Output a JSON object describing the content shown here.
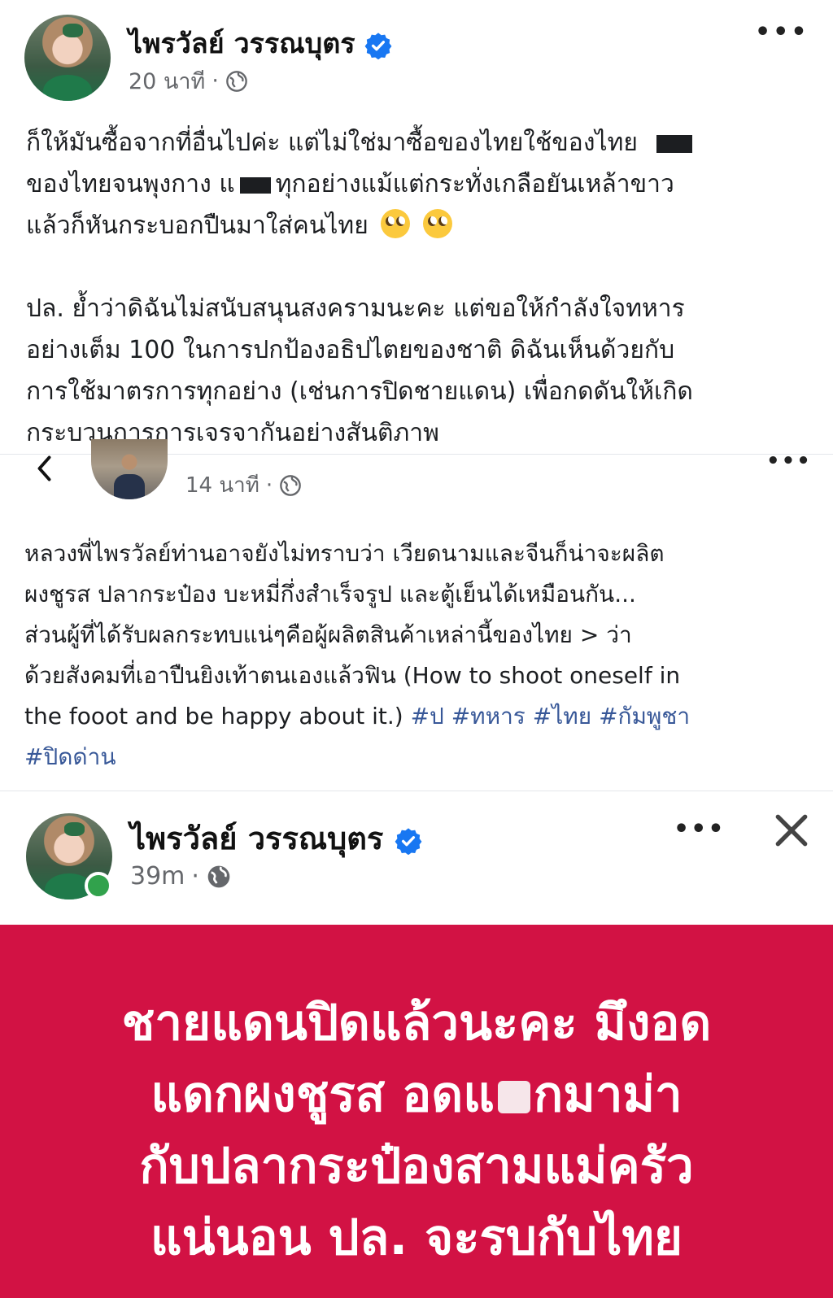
{
  "post1": {
    "author": "ไพรวัลย์ วรรณบุตร",
    "time": "20 นาที",
    "body_lines": [
      "ก็ให้มันซื้อจากที่อื่นไปค่ะ แต่ไม่ใช่มาซื้อของไทยใช้ของไทย",
      "ของไทยจนพุงกาง แ",
      "ทุกอย่างแม้แต่กระทั่งเกลือยันเหล้าขาว",
      "แล้วก็หันกระบอกปืนมาใส่คนไทย"
    ],
    "body_lines_2": [
      "ปล. ย้ำว่าดิฉันไม่สนับสนุนสงครามนะคะ แต่ขอให้กำลังใจทหาร",
      "อย่างเต็ม 100 ในการปกป้องอธิปไตยของชาติ  ดิฉันเห็นด้วยกับ",
      "การใช้มาตรการทุกอย่าง (เช่นการปิดชายแดน) เพื่อกดดันให้เกิด",
      "กระบวนการการเจรจากันอย่างสันติภาพ"
    ],
    "emoji": "face-with-rolling-eyes"
  },
  "post2": {
    "time": "14 นาที",
    "body_lines": [
      "หลวงพี่ไพรวัลย์ท่านอาจยังไม่ทราบว่า เวียดนามและจีนก็น่าจะผลิต",
      "ผงชูรส ปลากระป๋อง บะหมี่กึ่งสำเร็จรูป และตู้เย็นได้เหมือนกัน...",
      "ส่วนผู้ที่ได้รับผลกระทบแน่ๆคือผู้ผลิตสินค้าเหล่านี้ของไทย > ว่า",
      "ด้วยสังคมที่เอาปืนยิงเท้าตนเองแล้วฟิน (How to shoot oneself in",
      "the fooot and be happy about it.)"
    ],
    "hashtags_line1": [
      "#ป",
      "#ทหาร",
      "#ไทย",
      "#กัมพูชา"
    ],
    "hashtags_line2": [
      "#ปิดด่าน"
    ]
  },
  "post3": {
    "author": "ไพรวัลย์ วรรณบุตร",
    "time": "39m",
    "banner_lines": [
      "ชายแดนปิดแล้วนะคะ มึงอด",
      "แดกผงชูรส อดแ",
      "กมาม่า",
      "กับปลากระป๋องสามแม่ครัว",
      "แน่นอน ปล. จะรบกับไทย"
    ],
    "banner_color": "#d21244"
  },
  "colors": {
    "verified": "#1877f2",
    "hashtag": "#385898",
    "online": "#31a24c"
  }
}
